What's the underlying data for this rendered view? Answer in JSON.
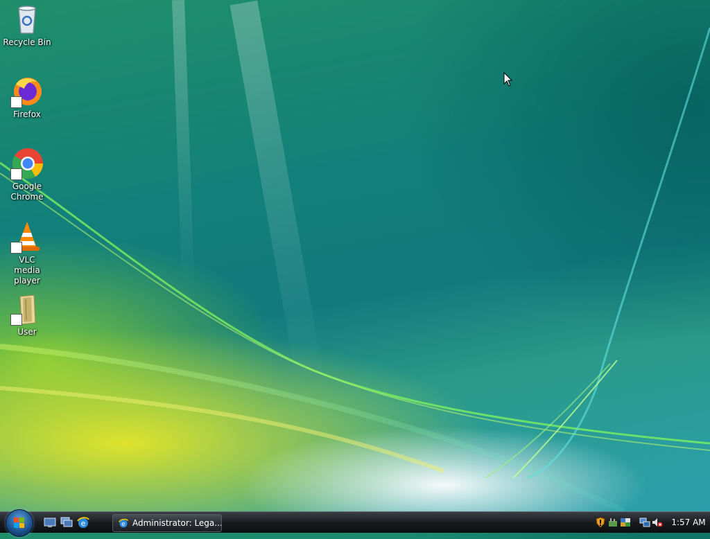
{
  "desktop": {
    "icons": [
      {
        "label": "Recycle Bin",
        "icon": "recycle-bin-icon",
        "shortcut": false
      },
      {
        "label": "Firefox",
        "icon": "firefox-icon",
        "shortcut": true
      },
      {
        "label": "Google Chrome",
        "icon": "chrome-icon",
        "shortcut": true
      },
      {
        "label": "VLC media player",
        "icon": "vlc-icon",
        "shortcut": true
      },
      {
        "label": "User",
        "icon": "user-folder-icon",
        "shortcut": true
      }
    ]
  },
  "taskbar": {
    "start_button": "windows-start-orb-icon",
    "quick_launch": [
      "show-desktop-icon",
      "switch-windows-icon",
      "internet-explorer-icon"
    ],
    "task_buttons": [
      {
        "label": "Administrator: Lega...",
        "icon": "internet-explorer-icon"
      }
    ],
    "tray_icons": [
      "security-warning-icon",
      "program-icon",
      "network-app-icon",
      "network-icon",
      "volume-muted-icon"
    ],
    "clock": "1:57 AM"
  },
  "colors": {
    "taskbar": "#1a1c1f",
    "wallpaper_teal": "#12807a",
    "wallpaper_yellow": "#e6e628",
    "wallpaper_green": "#96dc28"
  }
}
